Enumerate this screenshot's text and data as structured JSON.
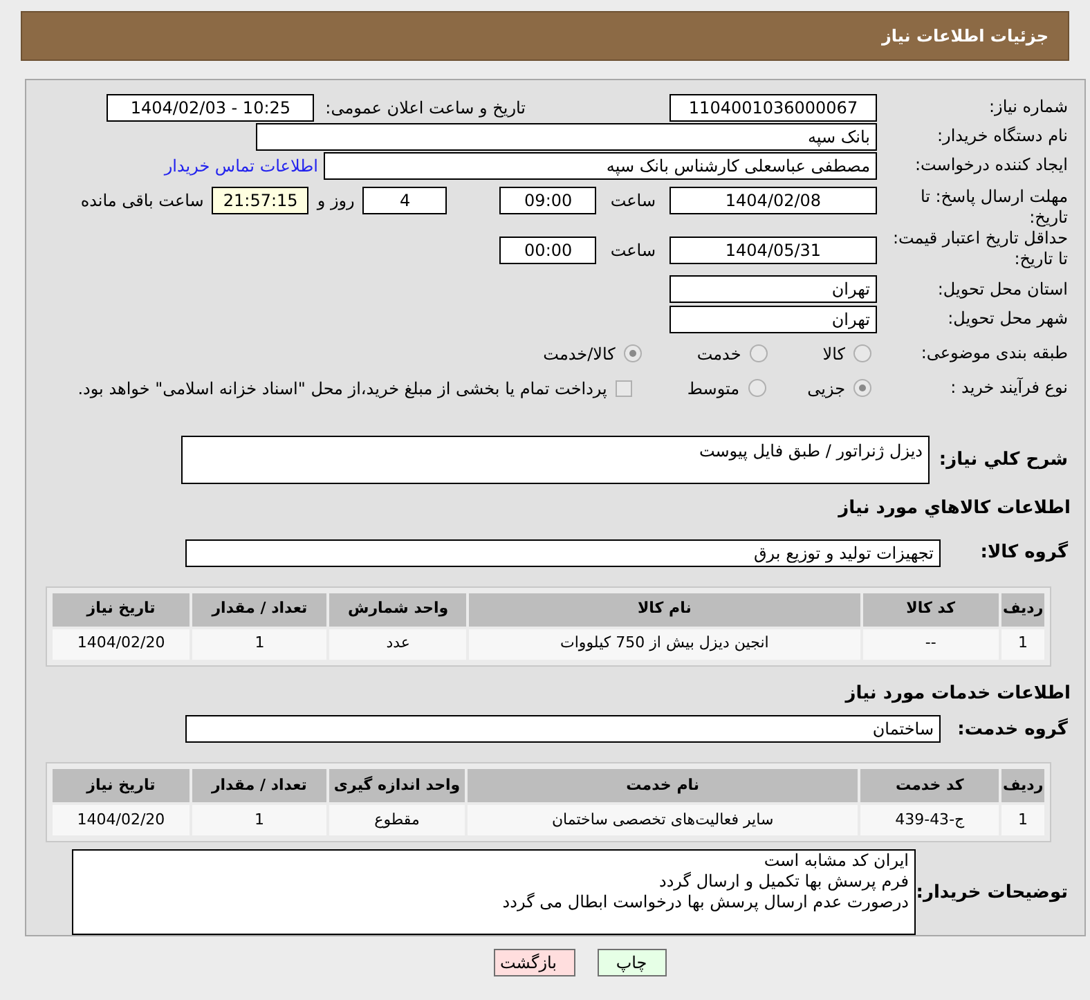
{
  "page_title": "جزئیات اطلاعات نیاز",
  "need_number": {
    "label": "شماره نیاز:",
    "value": "1104001036000067"
  },
  "announce": {
    "label": "تاریخ و ساعت اعلان عمومی:",
    "value": "1404/02/03 - 10:25"
  },
  "buyer_org": {
    "label": "نام دستگاه خریدار:",
    "value": "بانک سپه"
  },
  "requester": {
    "label": "ایجاد کننده درخواست:",
    "value": "مصطفی عباسعلی کارشناس بانک سپه",
    "link": "اطلاعات تماس خریدار"
  },
  "response_deadline": {
    "label": "مهلت ارسال پاسخ: تا تاریخ:",
    "date": "1404/02/08",
    "time_label": "ساعت",
    "time": "09:00",
    "days": "4",
    "days_label": "روز و",
    "remaining": "21:57:15",
    "remaining_label": "ساعت باقی مانده"
  },
  "price_validity": {
    "label": "حداقل تاریخ اعتبار قیمت: تا تاریخ:",
    "date": "1404/05/31",
    "time_label": "ساعت",
    "time": "00:00"
  },
  "province": {
    "label": "استان محل تحویل:",
    "value": "تهران"
  },
  "city": {
    "label": "شهر محل تحویل:",
    "value": "تهران"
  },
  "category": {
    "label": "طبقه بندی موضوعی:",
    "options": [
      {
        "label": "کالا",
        "selected": false
      },
      {
        "label": "خدمت",
        "selected": false
      },
      {
        "label": "کالا/خدمت",
        "selected": true
      }
    ]
  },
  "purchase_process": {
    "label": "نوع فرآیند خرید :",
    "options": [
      {
        "label": "جزیی",
        "selected": true
      },
      {
        "label": "متوسط",
        "selected": false
      }
    ],
    "payment_note": {
      "checked": false,
      "text": "پرداخت تمام یا بخشی از مبلغ خرید،از محل \"اسناد خزانه اسلامی\" خواهد بود."
    }
  },
  "description": {
    "label": "شرح کلي نیاز:",
    "value": "دیزل ژنراتور / طبق فایل پیوست"
  },
  "goods": {
    "heading": "اطلاعات کالاهاي مورد نیاز",
    "group_label": "گروه کالا:",
    "group": "تجهیزات تولید و توزیع برق",
    "table": {
      "columns": [
        "ردیف",
        "کد کالا",
        "نام کالا",
        "واحد شمارش",
        "تعداد / مقدار",
        "تاریخ نیاز"
      ],
      "rows": [
        [
          "1",
          "--",
          "انجین دیزل بیش از 750 کیلووات",
          "عدد",
          "1",
          "1404/02/20"
        ]
      ]
    }
  },
  "services": {
    "heading": "اطلاعات خدمات مورد نیاز",
    "group_label": "گروه خدمت:",
    "group": "ساختمان",
    "table": {
      "columns": [
        "ردیف",
        "کد خدمت",
        "نام خدمت",
        "واحد اندازه گیری",
        "تعداد / مقدار",
        "تاریخ نیاز"
      ],
      "rows": [
        [
          "1",
          "ج-43-439",
          "سایر فعالیت‌های تخصصی ساختمان",
          "مقطوع",
          "1",
          "1404/02/20"
        ]
      ]
    }
  },
  "buyer_notes": {
    "label": "توضیحات خریدار:",
    "lines": [
      "ایران کد مشابه است",
      "فرم پرسش بها تکمیل و ارسال گردد",
      "درصورت عدم ارسال پرسش بها درخواست ابطال می گردد"
    ]
  },
  "buttons": [
    {
      "label": "چاپ",
      "kind": "print"
    },
    {
      "label": "بازگشت",
      "kind": "back"
    }
  ]
}
